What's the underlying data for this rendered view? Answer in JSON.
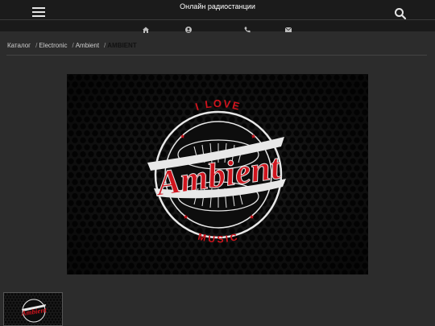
{
  "header": {
    "title": "Онлайн радиостанции"
  },
  "contacts": {
    "icons": [
      "home-icon",
      "user-icon",
      "phone-icon",
      "mail-icon"
    ]
  },
  "breadcrumbs": {
    "items": [
      "Каталог",
      "Electronic",
      "Ambient"
    ],
    "current": "AMBIENT"
  },
  "artwork": {
    "top_text": "I LOVE",
    "main_text": "Ambient",
    "bottom_text": "MUSIC"
  },
  "colors": {
    "accent_red": "#d0141d",
    "background": "#2c2c2c",
    "header": "#1b1b1b"
  }
}
